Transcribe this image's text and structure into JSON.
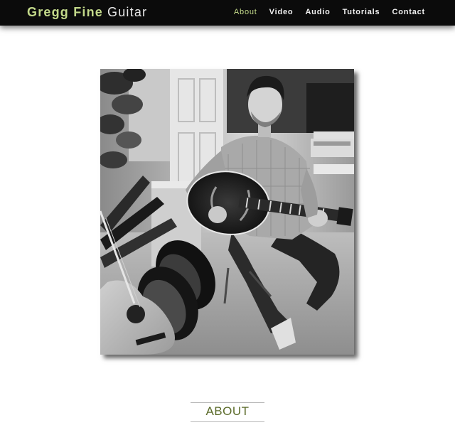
{
  "header": {
    "brand_name": "Gregg Fine",
    "brand_sub": "Guitar"
  },
  "nav": {
    "items": [
      {
        "label": "About",
        "active": true
      },
      {
        "label": "Video",
        "active": false
      },
      {
        "label": "Audio",
        "active": false
      },
      {
        "label": "Tutorials",
        "active": false
      },
      {
        "label": "Contact",
        "active": false
      }
    ]
  },
  "hero": {
    "image": "black-and-white photo of a guitarist seated on a stool holding an archtop guitar in a home studio"
  },
  "section": {
    "title": "ABOUT"
  },
  "colors": {
    "header_bg": "#0b0b0b",
    "accent": "#c3d98a",
    "section_title": "#5b6b2a"
  }
}
